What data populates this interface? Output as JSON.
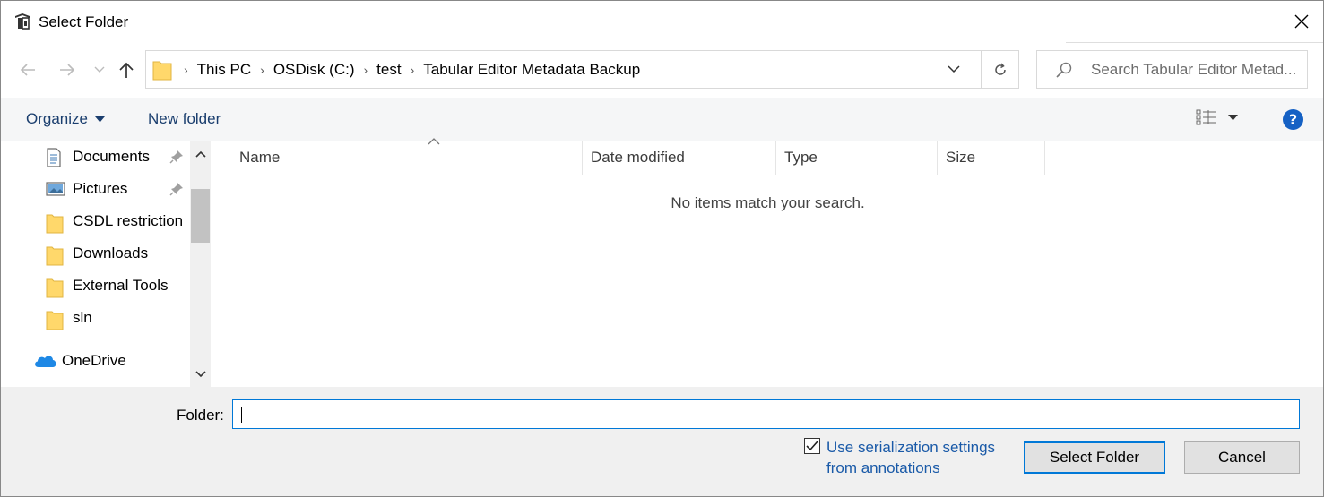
{
  "window": {
    "title": "Select Folder"
  },
  "address": {
    "crumbs": [
      "This PC",
      "OSDisk (C:)",
      "test",
      "Tabular Editor Metadata Backup"
    ]
  },
  "search": {
    "placeholder": "Search Tabular Editor Metad..."
  },
  "toolbar": {
    "organize_label": "Organize",
    "new_folder_label": "New folder",
    "help_label": "?"
  },
  "nav": {
    "items": [
      {
        "label": "Documents",
        "icon": "documents-icon",
        "pinned": true
      },
      {
        "label": "Pictures",
        "icon": "pictures-icon",
        "pinned": true
      },
      {
        "label": "CSDL restriction",
        "icon": "folder-icon",
        "pinned": false
      },
      {
        "label": "Downloads",
        "icon": "folder-icon",
        "pinned": false
      },
      {
        "label": "External Tools",
        "icon": "folder-icon",
        "pinned": false
      },
      {
        "label": "sln",
        "icon": "folder-icon",
        "pinned": false
      },
      {
        "label": "OneDrive",
        "icon": "onedrive-icon",
        "pinned": false
      }
    ]
  },
  "list": {
    "columns": [
      "Name",
      "Date modified",
      "Type",
      "Size"
    ],
    "empty_message": "No items match your search."
  },
  "bottom": {
    "folder_label": "Folder:",
    "folder_value": "",
    "checkbox_label": "Use serialization settings from annotations",
    "checkbox_checked": true,
    "select_label": "Select Folder",
    "cancel_label": "Cancel"
  },
  "colors": {
    "accent": "#0078d7",
    "link": "#1a5aa8",
    "folder": "#ffd86b"
  }
}
